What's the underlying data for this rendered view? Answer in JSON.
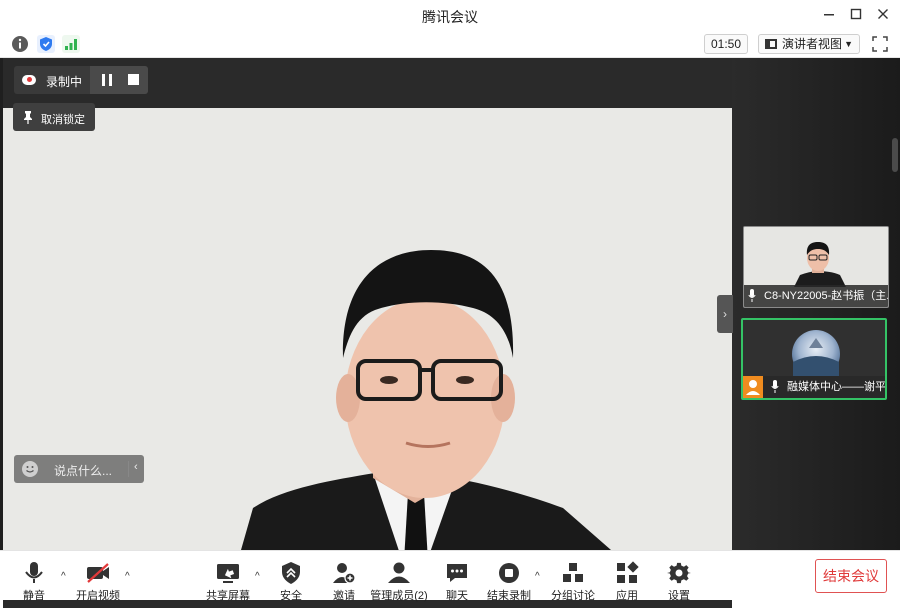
{
  "window": {
    "title": "腾讯会议"
  },
  "top_bar": {
    "timer": "01:50",
    "view_mode": "演讲者视图"
  },
  "recording": {
    "label": "录制中"
  },
  "unlock": {
    "label": "取消锁定"
  },
  "chat": {
    "placeholder": "说点什么..."
  },
  "participants": [
    {
      "name": "C8-NY22005-赵书振（主..."
    },
    {
      "name": "融媒体中心——谢平..."
    }
  ],
  "toolbar": {
    "mute": "静音",
    "video": "开启视频",
    "share": "共享屏幕",
    "security": "安全",
    "invite": "邀请",
    "members": "管理成员(2)",
    "chat": "聊天",
    "stop_record": "结束录制",
    "breakout": "分组讨论",
    "apps": "应用",
    "settings": "设置",
    "end_meeting": "结束会议"
  },
  "colors": {
    "end_red": "#e03a3a",
    "active_green": "#34c366",
    "video_off_red": "#e2393a"
  }
}
